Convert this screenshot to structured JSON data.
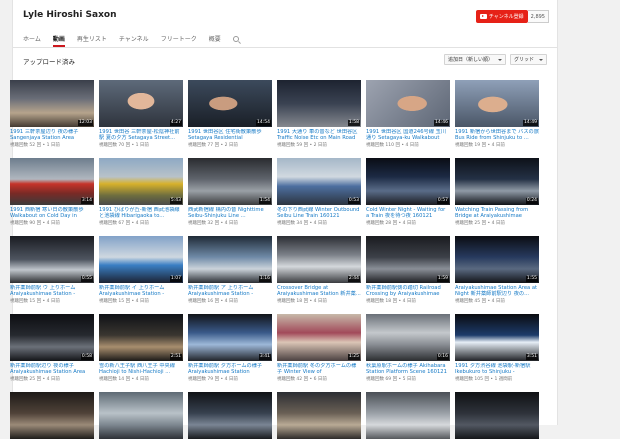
{
  "channel": {
    "title": "Lyle Hiroshi Saxon",
    "subscribe_label": "チャンネル登録",
    "subscriber_count": "2,895"
  },
  "tabs": [
    {
      "label": "ホーム",
      "active": false
    },
    {
      "label": "動画",
      "active": true
    },
    {
      "label": "再生リスト",
      "active": false
    },
    {
      "label": "チャンネル",
      "active": false
    },
    {
      "label": "フリートーク",
      "active": false
    },
    {
      "label": "概要",
      "active": false
    }
  ],
  "section": {
    "title": "アップロード済み",
    "sort_label": "追加日（新しい順）",
    "view_label": "グリッド"
  },
  "videos": [
    {
      "title": "1991 三軒茶屋辺り 夜の様子 Sangenjaya Station Area",
      "meta": "視聴回数 52 回 • 1 日前",
      "duration": "12:03",
      "thumb": "t-a"
    },
    {
      "title": "1991 世田谷 三軒茶屋-松陰神社前駅 夏の夕方 Setagaya Street...",
      "meta": "視聴回数 70 回 • 1 日前",
      "duration": "4:27",
      "thumb": "t-b"
    },
    {
      "title": "1991 世田谷区 住宅街散策散歩 Setagaya Residential Walkabout...",
      "meta": "視聴回数 77 回 • 2 日前",
      "duration": "14:54",
      "thumb": "t-c"
    },
    {
      "title": "1991 大通り 車の音など 世田谷区 Traffic Noise Etc on Main Road ...",
      "meta": "視聴回数 59 回 • 2 日前",
      "duration": "1:58",
      "thumb": "t-d"
    },
    {
      "title": "1991 世田谷区 国道246号線 玉川通り Setagaya-ku Walkabout by...",
      "meta": "視聴回数 110 回 • 4 日前",
      "duration": "14:46",
      "thumb": "t-e"
    },
    {
      "title": "1991 新宿から世田谷まで バスの旅 Bus Ride from Shinjuku to ...",
      "meta": "視聴回数 19 回 • 4 日前",
      "duration": "14:49",
      "thumb": "t-f"
    },
    {
      "title": "1991 西新宿 寒い日の散策散歩 Walkabout on Cold Day in Nishi...",
      "meta": "視聴回数 90 回 • 4 日前",
      "duration": "3:14",
      "thumb": "t-g"
    },
    {
      "title": "1991 ひばりが丘-新宿 西武池袋線と池袋線 Hibarigaoka to...",
      "meta": "視聴回数 67 回 • 4 日前",
      "duration": "5:43",
      "thumb": "t-h"
    },
    {
      "title": "西武新宿線 構内の音 Nighttime Seibu-Shinjuku Line ...",
      "meta": "視聴回数 32 回 • 4 日前",
      "duration": "1:54",
      "thumb": "t-i"
    },
    {
      "title": "冬の下り西武線 Winter Outbound Seibu Line Train 160121",
      "meta": "視聴回数 34 回 • 4 日前",
      "duration": "0:53",
      "thumb": "t-j"
    },
    {
      "title": "Cold Winter Night - Waiting for a Train 夜を待つ夜 160121",
      "meta": "視聴回数 28 回 • 4 日前",
      "duration": "0:57",
      "thumb": "t-k"
    },
    {
      "title": "Watching Train Passing from Bridge at Araiyakushimae Station...",
      "meta": "視聴回数 25 回 • 4 日前",
      "duration": "0:24",
      "thumb": "t-l"
    },
    {
      "title": "新井薬師前駅 ウ 上りホーム Araiyakushimae Station -",
      "meta": "視聴回数 15 回 • 4 日前",
      "duration": "0:55",
      "thumb": "t-m"
    },
    {
      "title": "新井薬師前駅 イ 上りホーム Araiyakushimae Station -",
      "meta": "視聴回数 15 回 • 4 日前",
      "duration": "1:07",
      "thumb": "t-n"
    },
    {
      "title": "新井薬師前駅 ア 上りホーム Araiyakushimae Station -",
      "meta": "視聴回数 16 回 • 4 日前",
      "duration": "1:16",
      "thumb": "t-o"
    },
    {
      "title": "Crossover Bridge at Araiyakushimae Station 新井薬...",
      "meta": "視聴回数 18 回 • 4 日前",
      "duration": "2:44",
      "thumb": "t-p"
    },
    {
      "title": "新井薬師前駅側の踏切 Railroad Crossing by Araiyakushimae",
      "meta": "視聴回数 18 回 • 4 日前",
      "duration": "1:59",
      "thumb": "t-q"
    },
    {
      "title": "Araiyakushimae Station Area at Night 新井薬師前駅辺り 夜の...",
      "meta": "視聴回数 45 回 • 4 日前",
      "duration": "1:55",
      "thumb": "t-r"
    },
    {
      "title": "新井薬師前駅辺り 夜の様子 Araiyakushimae Station Area at...",
      "meta": "視聴回数 25 回 • 4 日前",
      "duration": "0:58",
      "thumb": "t-s"
    },
    {
      "title": "雪の新八王子駅 西八王子 中央線 Hachioji to Nishi-Hachioji ...",
      "meta": "視聴回数 14 回 • 4 日前",
      "duration": "2:51",
      "thumb": "t-t"
    },
    {
      "title": "新井薬師前駅 夕方ホームの様子 Araiyakushimae Station Evening...",
      "meta": "視聴回数 79 回 • 4 日前",
      "duration": "3:41",
      "thumb": "t-u"
    },
    {
      "title": "新井薬師前駅 冬の夕方ホームの様子 Winter View of",
      "meta": "視聴回数 42 回 • 6 日前",
      "duration": "1:25",
      "thumb": "t-v"
    },
    {
      "title": "秋葉原駅ホームの様子 Akihabara Station Platform Scene 160121",
      "meta": "視聴回数 69 回 • 5 日前",
      "duration": "0:16",
      "thumb": "t-w"
    },
    {
      "title": "1991 夕方渋谷線 池袋駅-新宿駅 Ikebukuro to Shinjuku - Afternoo...",
      "meta": "視聴回数 105 回 • 1 週間前",
      "duration": "3:51",
      "thumb": "t-x"
    },
    {
      "title": "",
      "meta": "",
      "duration": "",
      "thumb": "t-y"
    },
    {
      "title": "",
      "meta": "",
      "duration": "",
      "thumb": "t-z"
    },
    {
      "title": "",
      "meta": "",
      "duration": "",
      "thumb": "t-aa"
    },
    {
      "title": "",
      "meta": "",
      "duration": "",
      "thumb": "t-ab"
    },
    {
      "title": "",
      "meta": "",
      "duration": "",
      "thumb": "t-ac"
    },
    {
      "title": "",
      "meta": "",
      "duration": "",
      "thumb": "t-ad"
    }
  ]
}
